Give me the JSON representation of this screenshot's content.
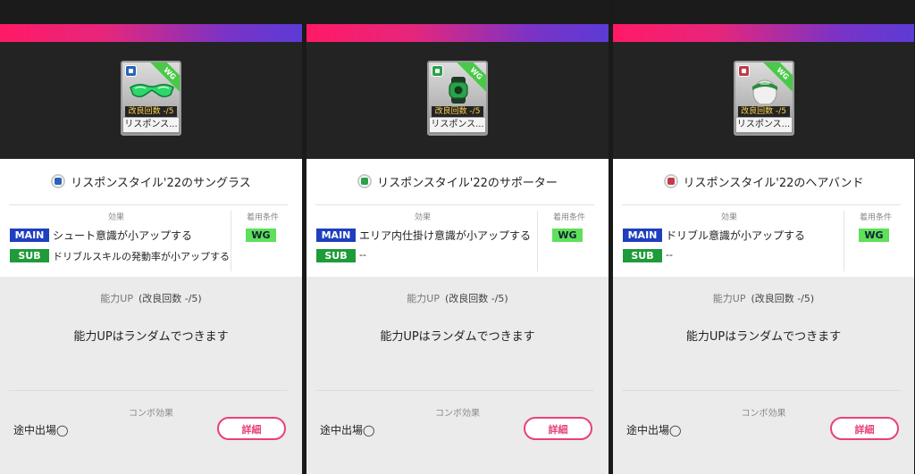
{
  "panels": [
    {
      "card": {
        "ribbon": "WG",
        "kairyo": "改良回数 -/5",
        "name": "リスポンス..."
      },
      "title": "リスポンスタイル'22のサングラス",
      "effect_label": "効果",
      "cond_label": "着用条件",
      "main_badge": "MAIN",
      "main_text": "シュート意識が小アップする",
      "sub_badge": "SUB",
      "sub_text": "ドリブルスキルの発動率が小アップする",
      "wg": "WG",
      "ability_label": "能力UP",
      "ability_count": "(改良回数 -/5)",
      "ability_random": "能力UPはランダムでつきます",
      "combo_label": "コンボ効果",
      "combo_text": "途中出場◯",
      "detail_btn": "詳細",
      "icon_color": "#2b63b8"
    },
    {
      "card": {
        "ribbon": "WG",
        "kairyo": "改良回数 -/5",
        "name": "リスポンス..."
      },
      "title": "リスポンスタイル'22のサポーター",
      "effect_label": "効果",
      "cond_label": "着用条件",
      "main_badge": "MAIN",
      "main_text": "エリア内仕掛け意識が小アップする",
      "sub_badge": "SUB",
      "sub_text": "--",
      "wg": "WG",
      "ability_label": "能力UP",
      "ability_count": "(改良回数 -/5)",
      "ability_random": "能力UPはランダムでつきます",
      "combo_label": "コンボ効果",
      "combo_text": "途中出場◯",
      "detail_btn": "詳細",
      "icon_color": "#2aa14a"
    },
    {
      "card": {
        "ribbon": "WG",
        "kairyo": "改良回数 -/5",
        "name": "リスポンス..."
      },
      "title": "リスポンスタイル'22のヘアバンド",
      "effect_label": "効果",
      "cond_label": "着用条件",
      "main_badge": "MAIN",
      "main_text": "ドリブル意識が小アップする",
      "sub_badge": "SUB",
      "sub_text": "--",
      "wg": "WG",
      "ability_label": "能力UP",
      "ability_count": "(改良回数 -/5)",
      "ability_random": "能力UPはランダムでつきます",
      "combo_label": "コンボ効果",
      "combo_text": "途中出場◯",
      "detail_btn": "詳細",
      "icon_color": "#c23b4a"
    }
  ]
}
